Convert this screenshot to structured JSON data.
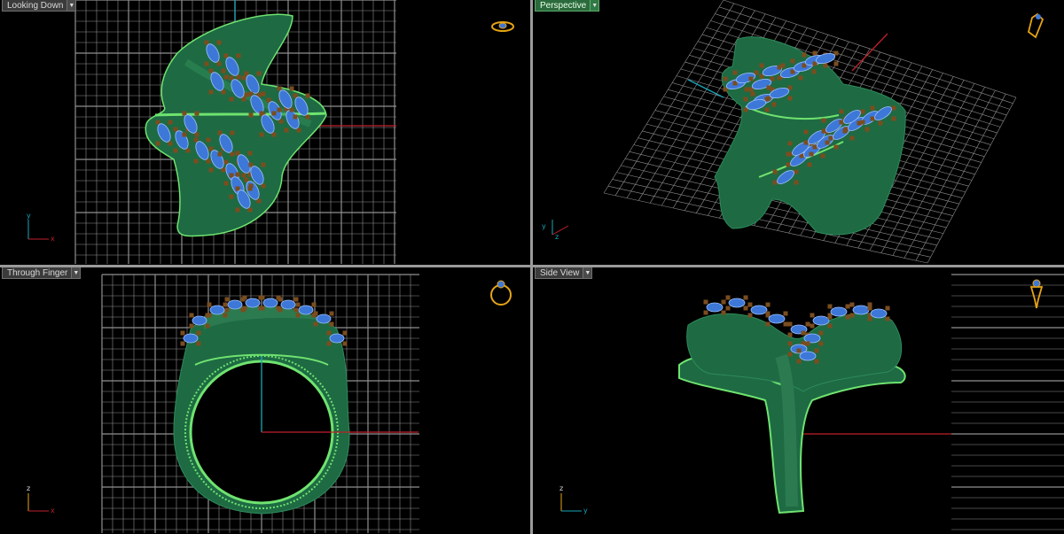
{
  "viewports": [
    {
      "id": "top-left",
      "label": "Looking Down",
      "active": false,
      "axis_a": "y",
      "axis_b": "x"
    },
    {
      "id": "top-right",
      "label": "Perspective",
      "active": true,
      "axis_a": "y",
      "axis_b": "z"
    },
    {
      "id": "bottom-left",
      "label": "Through Finger",
      "active": false,
      "axis_a": "z",
      "axis_b": "x"
    },
    {
      "id": "bottom-right",
      "label": "Side View",
      "active": false,
      "axis_a": "z",
      "axis_b": "y"
    }
  ],
  "view_menu_icon": "chevron-down-icon",
  "colors": {
    "ring_green": "#1e6a43",
    "ring_edge": "#6fe36f",
    "gem_blue": "#3d78d8",
    "prong_brown": "#7a4d1f",
    "ruby_red": "#d0393a",
    "grid": "#8f8f8f",
    "axis_red": "#c0202a",
    "axis_cyan": "#1aa6b8",
    "gold_icon": "#e6a416",
    "active_tab": "#2b6a3c"
  }
}
